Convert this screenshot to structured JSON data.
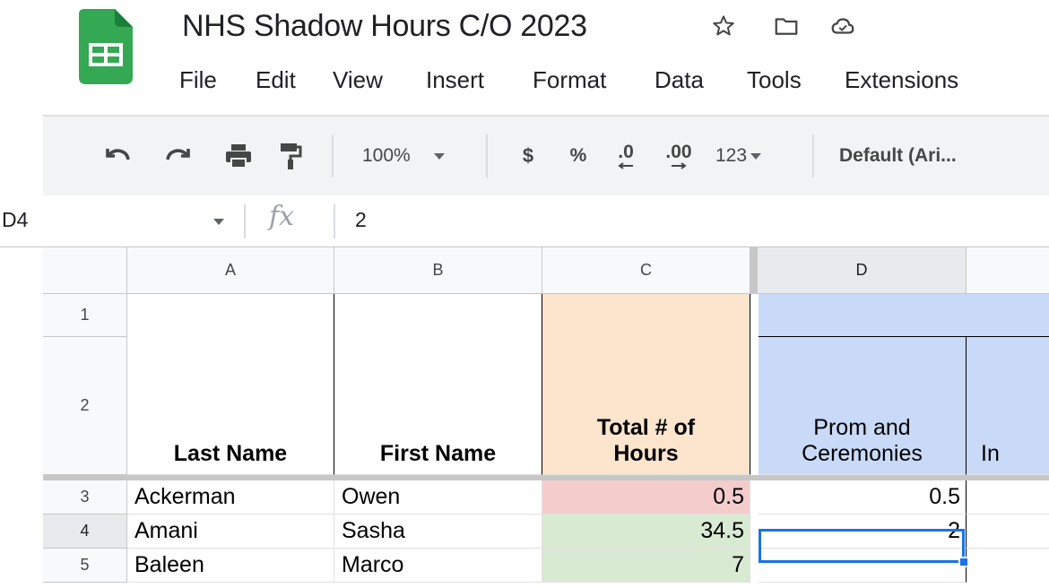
{
  "app": {
    "title": "NHS Shadow Hours C/O 2023",
    "brand_color": "#34a853",
    "icons": [
      "star-icon",
      "folder-icon",
      "cloud-icon"
    ]
  },
  "menu": [
    "File",
    "Edit",
    "View",
    "Insert",
    "Format",
    "Data",
    "Tools",
    "Extensions"
  ],
  "toolbar": {
    "zoom": "100%",
    "currency": "$",
    "percent": "%",
    "decrease_decimal": ".0",
    "increase_decimal": ".00",
    "number_format": "123",
    "font": "Default (Ari..."
  },
  "formula_bar": {
    "name_box": "D4",
    "fx": "fx",
    "value": "2"
  },
  "grid": {
    "columns": [
      "A",
      "B",
      "C",
      "D"
    ],
    "rows": [
      "1",
      "2",
      "3",
      "4",
      "5"
    ],
    "headers": {
      "last_name": "Last Name",
      "first_name": "First Name",
      "total_hours": "Total # of Hours",
      "prom": "Prom and Ceremonies",
      "partial_next": "In"
    },
    "data": [
      {
        "last": "Ackerman",
        "first": "Owen",
        "total": "0.5",
        "prom": "0.5"
      },
      {
        "last": "Amani",
        "first": "Sasha",
        "total": "34.5",
        "prom": "2"
      },
      {
        "last": "Baleen",
        "first": "Marco",
        "total": "7",
        "prom": ""
      }
    ],
    "colors": {
      "total_header_bg": "#fce5cd",
      "prom_header_bg": "#c9daf8",
      "low_total_bg": "#f4cccc",
      "high_total_bg": "#d9ead3",
      "selection": "#1a73e8"
    }
  }
}
